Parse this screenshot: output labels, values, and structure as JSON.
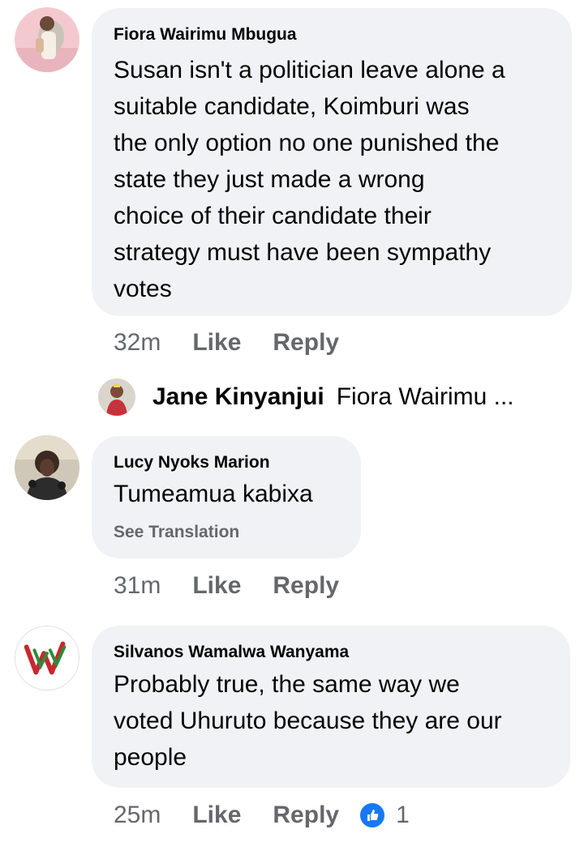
{
  "comments": [
    {
      "author": "Fiora Wairimu Mbugua",
      "lines": [
        "Susan isn't a politician leave alone a",
        "suitable candidate, Koimburi was",
        "the only option no one punished the",
        "state they just made a wrong",
        "choice of their candidate their",
        "strategy must have been sympathy",
        "votes"
      ],
      "time": "32m",
      "like_label": "Like",
      "reply_label": "Reply",
      "reply_preview": {
        "name": "Jane Kinyanjui",
        "text": "Fiora Wairimu ..."
      }
    },
    {
      "author": "Lucy Nyoks Marion",
      "lines": [
        "Tumeamua kabixa"
      ],
      "see_translation": "See Translation",
      "time": "31m",
      "like_label": "Like",
      "reply_label": "Reply"
    },
    {
      "author": "Silvanos Wamalwa Wanyama",
      "lines": [
        "Probably true, the same way we",
        "voted Uhuruto because they are our",
        "people"
      ],
      "time": "25m",
      "like_label": "Like",
      "reply_label": "Reply",
      "reaction": {
        "icon": "thumbs-up-icon",
        "count": "1",
        "color": "#1877f2"
      }
    }
  ],
  "colors": {
    "bubble": "#f0f2f5",
    "secondary_text": "#65676b",
    "primary_text": "#050505",
    "like_blue": "#1877f2"
  }
}
